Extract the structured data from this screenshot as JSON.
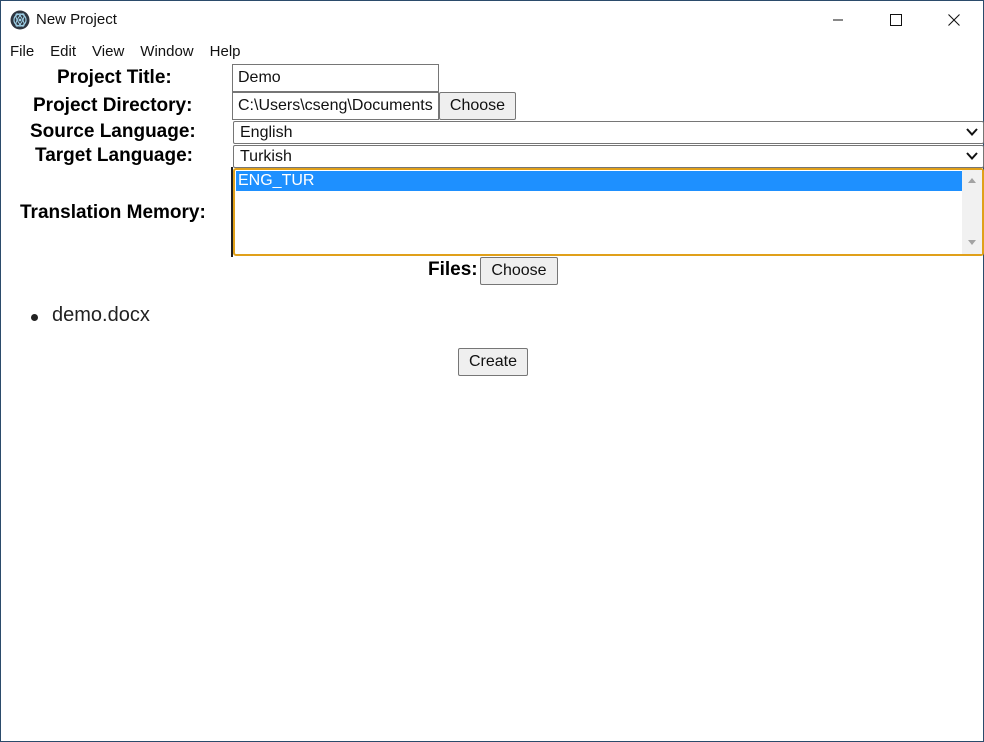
{
  "window": {
    "title": "New Project",
    "controls": {
      "minimize": "minimize-icon",
      "maximize": "maximize-icon",
      "close": "close-icon"
    }
  },
  "menu": [
    "File",
    "Edit",
    "View",
    "Window",
    "Help"
  ],
  "form": {
    "project_title_label": "Project Title:",
    "project_title_value": "Demo",
    "project_directory_label": "Project Directory:",
    "project_directory_value": "C:\\Users\\cseng\\Documents",
    "directory_choose_label": "Choose",
    "source_language_label": "Source Language:",
    "source_language_value": "English",
    "target_language_label": "Target Language:",
    "target_language_value": "Turkish",
    "translation_memory_label": "Translation Memory:",
    "translation_memory_options": [
      "ENG_TUR"
    ],
    "files_label": "Files:",
    "files_choose_label": "Choose",
    "files": [
      "demo.docx"
    ],
    "create_label": "Create"
  },
  "colors": {
    "selection": "#1e90ff",
    "focus_border": "#e0a01a"
  }
}
